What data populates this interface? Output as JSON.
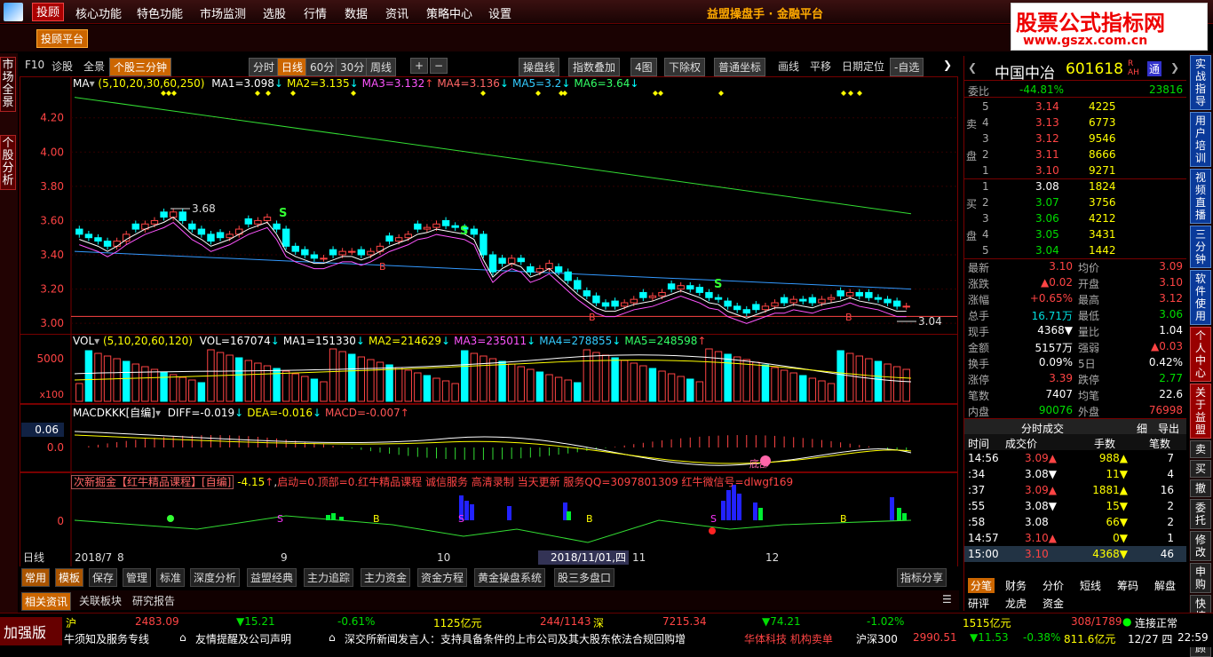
{
  "menubar": {
    "items": [
      "投顾",
      "核心功能",
      "特色功能",
      "市场监测",
      "选股",
      "行情",
      "数据",
      "资讯",
      "策略中心",
      "设置"
    ],
    "app_title": "益盟操盘手 · 金融平台",
    "tougu_platform": "投顾平台"
  },
  "watermark": {
    "line1": "股票公式指标网",
    "line2": "www.gszx.com.cn"
  },
  "leftbar": {
    "tab1": "市场全景",
    "tab2": "个股分析"
  },
  "toolbar": {
    "left": [
      "F10",
      "诊股",
      "全景"
    ],
    "active": "个股三分钟",
    "periods": [
      "分时",
      "日线",
      "60分",
      "30分"
    ],
    "week": "周线",
    "tools": [
      "操盘线",
      "指数叠加",
      "4图",
      "下除权",
      "普通坐标",
      "画线",
      "平移",
      "日期定位",
      "-自选"
    ]
  },
  "ma_legend": {
    "prefix": "MA",
    "params": "(5,10,20,30,60,250)",
    "items": [
      {
        "text": "MA1=3.098",
        "arrow": "↓",
        "color": "#ffffff"
      },
      {
        "text": "MA2=3.135",
        "arrow": "↓",
        "color": "#ffff00"
      },
      {
        "text": "MA3=3.132",
        "arrow": "↑",
        "color": "#ff55ff"
      },
      {
        "text": "MA4=3.136",
        "arrow": "↓",
        "color": "#ff6666"
      },
      {
        "text": "MA5=3.2",
        "arrow": "↓",
        "color": "#33ccff"
      },
      {
        "text": "MA6=3.64",
        "arrow": "↓",
        "color": "#33ff66"
      }
    ]
  },
  "vol_legend": {
    "prefix": "VOL",
    "params": "(5,10,20,60,120)",
    "items": [
      {
        "text": "VOL=167074",
        "arrow": "↓",
        "color": "#ffffff"
      },
      {
        "text": "MA1=151330",
        "arrow": "↓",
        "color": "#ffffff"
      },
      {
        "text": "MA2=214629",
        "arrow": "↓",
        "color": "#ffff00"
      },
      {
        "text": "MA3=235011",
        "arrow": "↓",
        "color": "#ff55ff"
      },
      {
        "text": "MA4=278855",
        "arrow": "↓",
        "color": "#33ccff"
      },
      {
        "text": "MA5=248598",
        "arrow": "↑",
        "color": "#33ff66"
      }
    ]
  },
  "macd_legend": {
    "prefix": "MACDKKK[自编]",
    "items": [
      {
        "text": "DIFF=-0.019",
        "arrow": "↓",
        "color": "#ffffff"
      },
      {
        "text": "DEA=-0.016",
        "arrow": "↓",
        "color": "#ffff00"
      },
      {
        "text": "MACD=-0.007",
        "arrow": "↑",
        "color": "#ff5555"
      }
    ]
  },
  "ind4_legend": {
    "prefix": "次新掘金【红牛精品课程】[自编]",
    "value": "-4.15",
    "text": "启动=0.顶部=0.红牛精品课程 诚信服务 高清录制 当天更新 服务QQ=3097801309 红牛微信号=dlwgf169"
  },
  "chart_data": {
    "type": "candlestick",
    "price_axis": [
      "4.20",
      "4.00",
      "3.80",
      "3.60",
      "3.40",
      "3.20",
      "3.00"
    ],
    "vol_axis": [
      "5000",
      "x100"
    ],
    "macd_axis": [
      "0.06",
      "0.0"
    ],
    "ind4_axis": [
      "0"
    ],
    "ylim": [
      2.98,
      4.38
    ],
    "annotations": {
      "high_label": "3.68",
      "low_label": "3.04",
      "S": "S",
      "B": "B",
      "bottom_label": "底部"
    },
    "x_labels": [
      "2018/7",
      "8",
      "9",
      "10",
      "11",
      "12"
    ],
    "cursor_date": "2018/11/01,四",
    "period_label": "日线",
    "ma250": [
      4.32,
      3.64
    ],
    "ma60": [
      3.42,
      3.2
    ],
    "closes": [
      3.52,
      3.5,
      3.48,
      3.45,
      3.48,
      3.52,
      3.55,
      3.58,
      3.6,
      3.62,
      3.65,
      3.6,
      3.55,
      3.52,
      3.48,
      3.5,
      3.52,
      3.55,
      3.58,
      3.6,
      3.62,
      3.55,
      3.45,
      3.42,
      3.4,
      3.38,
      3.38,
      3.4,
      3.42,
      3.42,
      3.4,
      3.42,
      3.45,
      3.48,
      3.5,
      3.52,
      3.55,
      3.56,
      3.58,
      3.57,
      3.56,
      3.55,
      3.52,
      3.4,
      3.3,
      3.35,
      3.38,
      3.36,
      3.3,
      3.32,
      3.35,
      3.3,
      3.25,
      3.2,
      3.16,
      3.12,
      3.1,
      3.1,
      3.12,
      3.14,
      3.15,
      3.16,
      3.18,
      3.2,
      3.22,
      3.2,
      3.18,
      3.15,
      3.14,
      3.1,
      3.08,
      3.06,
      3.08,
      3.1,
      3.12,
      3.12,
      3.14,
      3.13,
      3.12,
      3.14,
      3.15,
      3.16,
      3.18,
      3.16,
      3.15,
      3.14,
      3.12,
      3.1,
      3.1
    ]
  },
  "toolbar_bottom": {
    "left": "日线",
    "tabs": [
      "常用",
      "模板",
      "保存",
      "管理",
      "标准",
      "深度分析",
      "益盟经典",
      "主力追踪",
      "主力资金",
      "资金方程",
      "黄金操盘系统",
      "股三多盘口"
    ],
    "right": "指标分享"
  },
  "infotabs": [
    "相关资讯",
    "关联板块",
    "研究报告"
  ],
  "quote": {
    "name": "中国中冶",
    "code": "601618",
    "tag": "R AH",
    "weibi_label": "委比",
    "weibi": "-44.81%",
    "weicha": "23816",
    "sell_label": [
      "卖",
      "盘"
    ],
    "buy_label": [
      "买",
      "盘"
    ],
    "sells": [
      [
        "5",
        "3.14",
        "4225"
      ],
      [
        "4",
        "3.13",
        "6773"
      ],
      [
        "3",
        "3.12",
        "9546"
      ],
      [
        "2",
        "3.11",
        "8666"
      ],
      [
        "1",
        "3.10",
        "9271"
      ]
    ],
    "buys": [
      [
        "1",
        "3.08",
        "1824"
      ],
      [
        "2",
        "3.07",
        "3756"
      ],
      [
        "3",
        "3.06",
        "4212"
      ],
      [
        "4",
        "3.05",
        "3431"
      ],
      [
        "5",
        "3.04",
        "1442"
      ]
    ],
    "stats": [
      [
        "最新",
        "3.10",
        "red",
        "均价",
        "3.09",
        "red"
      ],
      [
        "涨跌",
        "▲0.02",
        "red",
        "开盘",
        "3.10",
        "red"
      ],
      [
        "涨幅",
        "+0.65%",
        "red",
        "最高",
        "3.12",
        "red"
      ],
      [
        "总手",
        "16.71万",
        "cyn",
        "最低",
        "3.06",
        "grn"
      ],
      [
        "现手",
        "4368▼",
        "wht",
        "量比",
        "1.04",
        "wht"
      ],
      [
        "金额",
        "5157万",
        "wht",
        "强弱",
        "▲0.03",
        "red"
      ],
      [
        "换手",
        "0.09%",
        "wht",
        "5日",
        "0.42%",
        "wht"
      ],
      [
        "涨停",
        "3.39",
        "red",
        "跌停",
        "2.77",
        "grn"
      ],
      [
        "笔数",
        "7407",
        "wht",
        "均笔",
        "22.6",
        "wht"
      ],
      [
        "内盘",
        "90076",
        "grn",
        "外盘",
        "76998",
        "red"
      ]
    ],
    "ticks_title": "分时成交",
    "ticks_actions": [
      "细",
      "导出"
    ],
    "ticks_header": [
      "时间",
      "成交价",
      "手数",
      "笔数"
    ],
    "ticks": [
      [
        "14:56",
        "3.09▲",
        "988▲",
        "7"
      ],
      [
        ":34",
        "3.08▼",
        "11▼",
        "4"
      ],
      [
        ":37",
        "3.09▲",
        "1881▲",
        "16"
      ],
      [
        ":55",
        "3.08▼",
        "15▼",
        "2"
      ],
      [
        ":58",
        "3.08",
        "66▼",
        "2"
      ],
      [
        "14:57",
        "3.10▲",
        "0▼",
        "1"
      ],
      [
        "15:00",
        "3.10",
        "4368▼",
        "46"
      ]
    ],
    "bottom_tabs": [
      "分笔",
      "财务",
      "分价",
      "短线",
      "筹码",
      "解盘"
    ],
    "bottom_tabs2": [
      "研评",
      "龙虎",
      "资金"
    ]
  },
  "farright": [
    "实战指导",
    "用户培训",
    "视频直播",
    "三分钟",
    "软件使用",
    "个人中心",
    "关于益盟",
    "卖",
    "买",
    "撤",
    "委托",
    "修改",
    "申购",
    "快捷",
    "投顾"
  ],
  "statusbar": {
    "sh_label": "沪",
    "sh_index": "2483.09",
    "sh_chg": "▼15.21",
    "sh_pct": "-0.61%",
    "sh_amt": "1125亿元",
    "sh_updown": "244/1143",
    "sz_label": "深",
    "sz_index": "7215.34",
    "sz_chg": "▼74.21",
    "sz_pct": "-1.02%",
    "sz_amt": "1515亿元",
    "sz_updown": "308/1789",
    "conn": "连接正常",
    "enhanced": "加强版",
    "ticker1": "牛须知及服务专线",
    "ticker2": "友情提醒及公司声明",
    "ticker3": "深交所新闻发言人：支持具备条件的上市公司及其大股东依法合规回购增",
    "ticker4": "华体科技 机构卖单",
    "hs300_label": "沪深300",
    "hs300": "2990.51",
    "hs300_chg": "▼11.53",
    "hs300_pct": "-0.38%",
    "hs300_amt": "811.6亿元",
    "date": "12/27 四",
    "time": "22:59"
  }
}
